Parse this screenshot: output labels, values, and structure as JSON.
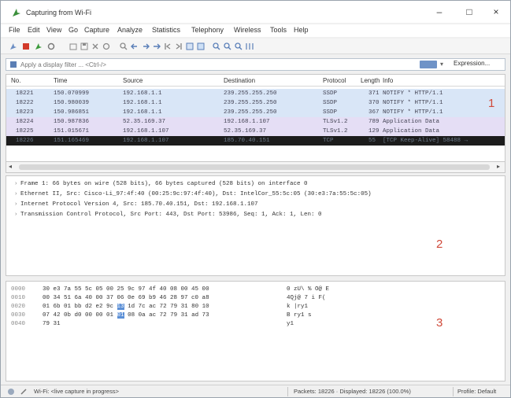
{
  "window": {
    "title": "Capturing from Wi-Fi",
    "controls": {
      "minimize": "–",
      "maximize": "□",
      "close": "×"
    }
  },
  "menu": [
    "File",
    "Edit",
    "View",
    "Go",
    "Capture",
    "Analyze",
    "Statistics",
    "Telephony",
    "Wireless",
    "Tools",
    "Help"
  ],
  "filter": {
    "placeholder": "Apply a display filter ... <Ctrl-/>",
    "expression_label": "Expression..."
  },
  "packet_list": {
    "columns": [
      "No.",
      "Time",
      "Source",
      "Destination",
      "Protocol",
      "Length",
      "Info"
    ],
    "rows": [
      {
        "no": "18221",
        "time": "150.070999",
        "src": "192.168.1.1",
        "dst": "239.255.255.250",
        "proto": "SSDP",
        "len": "371",
        "info": "NOTIFY * HTTP/1.1",
        "kind": "ssdp"
      },
      {
        "no": "18222",
        "time": "150.980039",
        "src": "192.168.1.1",
        "dst": "239.255.255.250",
        "proto": "SSDP",
        "len": "370",
        "info": "NOTIFY * HTTP/1.1",
        "kind": "ssdp"
      },
      {
        "no": "18223",
        "time": "150.986851",
        "src": "192.168.1.1",
        "dst": "239.255.255.250",
        "proto": "SSDP",
        "len": "367",
        "info": "NOTIFY * HTTP/1.1",
        "kind": "ssdp"
      },
      {
        "no": "18224",
        "time": "150.987836",
        "src": "52.35.169.37",
        "dst": "192.168.1.107",
        "proto": "TLSv1.2",
        "len": "789",
        "info": "Application Data",
        "kind": "tls"
      },
      {
        "no": "18225",
        "time": "151.015671",
        "src": "192.168.1.107",
        "dst": "52.35.169.37",
        "proto": "TLSv1.2",
        "len": "129",
        "info": "Application Data",
        "kind": "tls"
      },
      {
        "no": "18226",
        "time": "151.165469",
        "src": "192.168.1.107",
        "dst": "185.70.40.151",
        "proto": "TCP",
        "len": "55",
        "info": "[TCP Keep-Alive] 58488 →",
        "kind": "tcp"
      }
    ]
  },
  "details": [
    "Frame 1: 66 bytes on wire (528 bits), 66 bytes captured (528 bits) on interface 0",
    "Ethernet II, Src: Cisco-Li_97:4f:40 (00:25:9c:97:4f:40), Dst: IntelCor_55:5c:05 (30:e3:7a:55:5c:05)",
    "Internet Protocol Version 4, Src: 185.70.40.151, Dst: 192.168.1.107",
    "Transmission Control Protocol, Src Port: 443, Dst Port: 53986, Seq: 1, Ack: 1, Len: 0"
  ],
  "bytes": [
    {
      "off": "0000",
      "hex_a": "30 e3 7a 55 5c 05 00 25",
      "hex_h": "",
      "hex_b": "9c 97 4f 40 08 00 45 00",
      "asc_a": "0 zU\\ %",
      "asc_h": "",
      "asc_b": "O@ E"
    },
    {
      "off": "0010",
      "hex_a": "00 34 51 6a 40 00 37 06",
      "hex_h": "",
      "hex_b": "0e 69 b9 46 28 97 c0 a8",
      "asc_a": "4Qj@ 7",
      "asc_h": "",
      "asc_b": "i F("
    },
    {
      "off": "0020",
      "hex_a": "01 6b 01 bb d2 e2 9c",
      "hex_h": "13",
      "hex_b": "1d 7c ac 72 79 31 80 10",
      "asc_a": "k",
      "asc_h": "",
      "asc_b": "|ry1"
    },
    {
      "off": "0030",
      "hex_a": "07 42 0b d0 00 00 01",
      "hex_h": "01",
      "hex_b": "08 0a ac 72 79 31 ad 73",
      "asc_a": "B",
      "asc_h": "",
      "asc_b": "ry1 s"
    },
    {
      "off": "0040",
      "hex_a": "79 31",
      "hex_h": "",
      "hex_b": "",
      "asc_a": "y1",
      "asc_h": "",
      "asc_b": ""
    }
  ],
  "annotations": {
    "list": "1",
    "details": "2",
    "bytes": "3"
  },
  "status": {
    "capture": "Wi-Fi: <live capture in progress>",
    "packets": "Packets: 18226 · Displayed: 18226 (100.0%)",
    "profile": "Profile: Default"
  },
  "colors": {
    "ssdp_row": "#d9e6f7",
    "tls_row": "#e5def5",
    "selected_row": "#1c1c1c",
    "annotation": "#d04a3a",
    "highlight_byte": "#5b8fd6"
  }
}
